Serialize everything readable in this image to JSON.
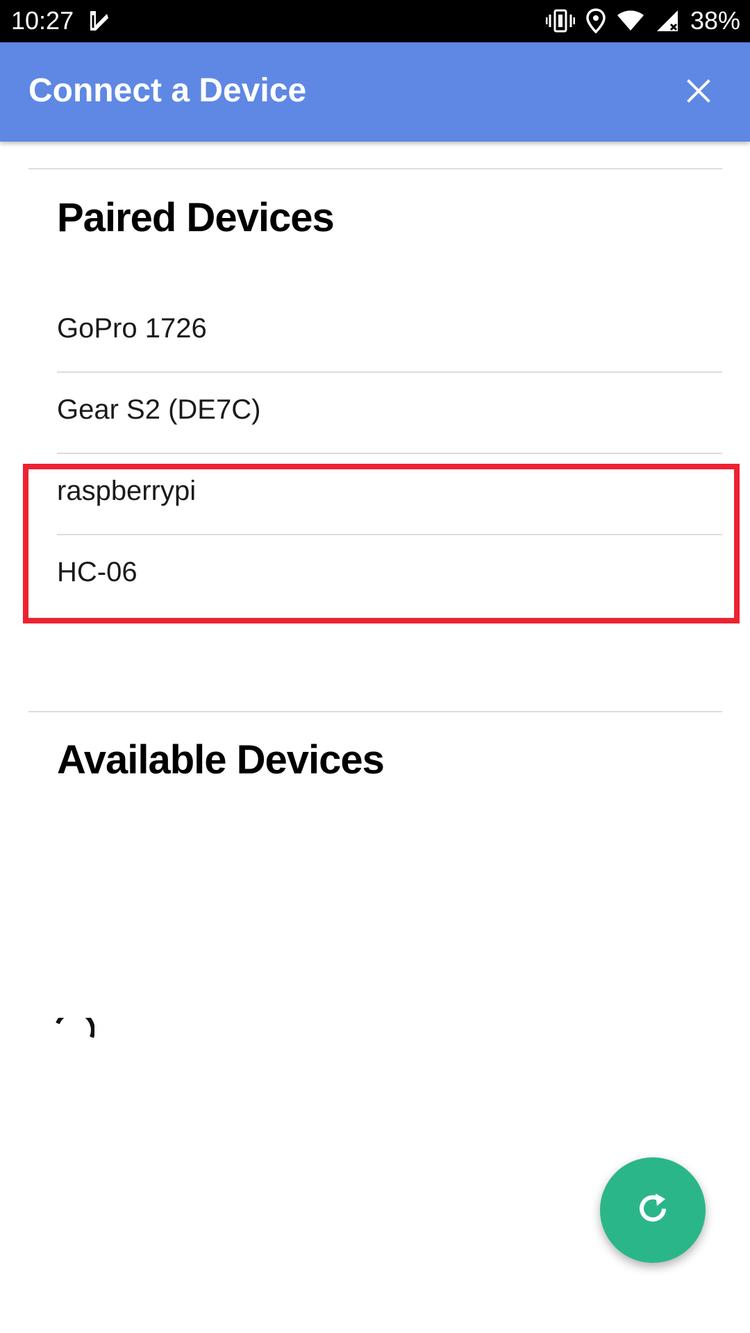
{
  "status_bar": {
    "time": "10:27",
    "battery_text": "38%",
    "icons": [
      "app-check-icon",
      "vibrate-icon",
      "location-icon",
      "wifi-icon",
      "cell-signal-icon",
      "battery-icon"
    ]
  },
  "app_bar": {
    "title": "Connect a Device",
    "close_icon": "close-icon",
    "background_color": "#5e88e3"
  },
  "paired_section": {
    "title": "Paired Devices",
    "devices": [
      {
        "label": "GoPro 1726"
      },
      {
        "label": "Gear S2 (DE7C)"
      },
      {
        "label": "raspberrypi"
      },
      {
        "label": "HC-06"
      }
    ],
    "highlight_color": "#ee2230"
  },
  "available_section": {
    "title": "Available Devices",
    "loading": true
  },
  "fab": {
    "icon": "refresh-icon",
    "color": "#2bb68a"
  }
}
